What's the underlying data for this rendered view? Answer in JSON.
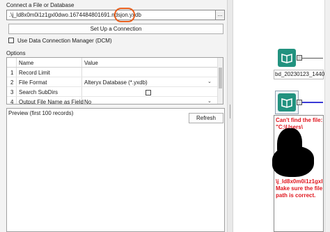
{
  "input": {
    "connect_label": "Connect a File or Database",
    "path_value": ".\\j_ld8x0m0i1z1gxl0dwo.1674484801691.ndsjon.yxdb",
    "browse_label": "...",
    "setup_button": "Set Up a Connection",
    "dcm_label": "Use Data Connection Manager (DCM)",
    "dcm_checked": false
  },
  "options": {
    "title": "Options",
    "headers": {
      "name": "Name",
      "value": "Value"
    },
    "rows": [
      {
        "num": "1",
        "name": "Record Limit",
        "value": ""
      },
      {
        "num": "2",
        "name": "File Format",
        "value": "Alteryx Database (*.yxdb)"
      },
      {
        "num": "3",
        "name": "Search SubDirs",
        "value": ""
      },
      {
        "num": "4",
        "name": "Output File Name as Field",
        "value": "No"
      }
    ]
  },
  "preview": {
    "label": "Preview (first 100 records)",
    "refresh_button": "Refresh"
  },
  "canvas": {
    "tool_label": "bd_20230123_144001.1.csv",
    "error_top": "Can't find the file: \"C:\\Users\\",
    "error_bottom": "\\j_ld8x0m0i1z1gxl0dwo.1674484801691.ndsjon.yxdb\". Make sure the file path is correct.",
    "tool_color": "#22927f",
    "error_color": "#e0151d"
  },
  "annotations": {
    "circle_color": "#e8601e",
    "highlight_color": "#f3e533"
  }
}
